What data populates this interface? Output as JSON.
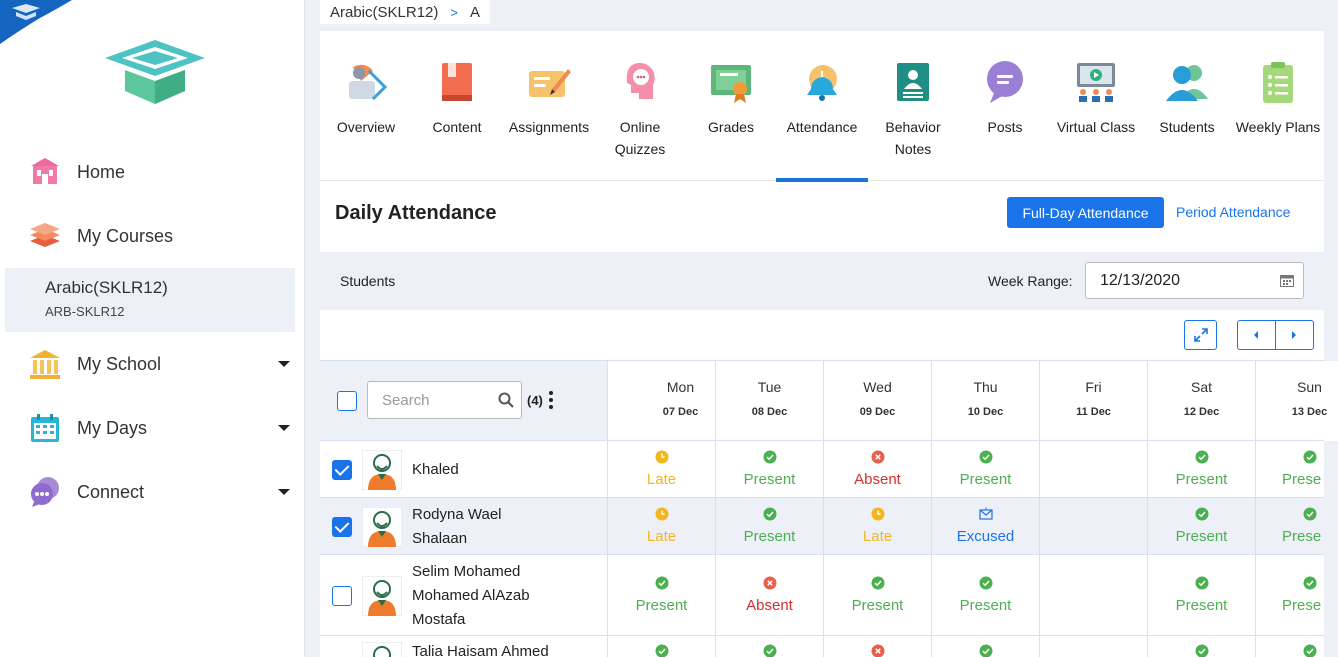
{
  "sidebar": {
    "items": [
      {
        "label": "Home",
        "icon": "school-building-icon"
      },
      {
        "label": "My Courses",
        "icon": "books-stack-icon"
      },
      {
        "label": "My School",
        "icon": "institution-icon"
      },
      {
        "label": "My Days",
        "icon": "calendar-icon"
      },
      {
        "label": "Connect",
        "icon": "chat-bubble-icon"
      }
    ],
    "course": {
      "name": "Arabic(SKLR12)",
      "code": "ARB-SKLR12"
    }
  },
  "breadcrumb": {
    "course": "Arabic(SKLR12)",
    "separator": ">",
    "section": "A"
  },
  "tabs": [
    {
      "label": "Overview",
      "icon": "overview-icon"
    },
    {
      "label": "Content",
      "icon": "book-icon"
    },
    {
      "label": "Assignments",
      "icon": "assignment-icon"
    },
    {
      "label": "Online Quizzes",
      "icon": "quiz-icon"
    },
    {
      "label": "Grades",
      "icon": "certificate-icon"
    },
    {
      "label": "Attendance",
      "icon": "alarm-bell-icon",
      "active": true
    },
    {
      "label": "Behavior Notes",
      "icon": "behavior-icon"
    },
    {
      "label": "Posts",
      "icon": "speech-bubble-icon"
    },
    {
      "label": "Virtual Class",
      "icon": "virtual-class-icon"
    },
    {
      "label": "Students",
      "icon": "students-icon"
    },
    {
      "label": "Weekly Plans",
      "icon": "checklist-icon"
    }
  ],
  "attendance": {
    "title": "Daily Attendance",
    "full_day_label": "Full-Day Attendance",
    "period_label": "Period Attendance",
    "students_label": "Students",
    "week_range_label": "Week Range:",
    "week_range_value": "12/13/2020",
    "search_placeholder": "Search",
    "count": "(4)"
  },
  "days": [
    {
      "name": "Mon",
      "date": "07 Dec"
    },
    {
      "name": "Tue",
      "date": "08 Dec"
    },
    {
      "name": "Wed",
      "date": "09 Dec"
    },
    {
      "name": "Thu",
      "date": "10 Dec"
    },
    {
      "name": "Fri",
      "date": "11 Dec"
    },
    {
      "name": "Sat",
      "date": "12 Dec"
    },
    {
      "name": "Sun",
      "date": "13 Dec"
    }
  ],
  "students": [
    {
      "name_lines": [
        "Khaled"
      ],
      "checked": true,
      "statuses": [
        "Late",
        "Present",
        "Absent",
        "Present",
        "",
        "Present",
        "Prese"
      ]
    },
    {
      "name_lines": [
        "Rodyna Wael",
        "Shalaan"
      ],
      "checked": true,
      "statuses": [
        "Late",
        "Present",
        "Late",
        "Excused",
        "",
        "Present",
        "Prese"
      ]
    },
    {
      "name_lines": [
        "Selim Mohamed",
        "Mohamed AlAzab",
        "Mostafa"
      ],
      "checked": false,
      "statuses": [
        "Present",
        "Absent",
        "Present",
        "Present",
        "",
        "Present",
        "Prese"
      ]
    },
    {
      "name_lines": [
        "Talia Haisam Ahmed"
      ],
      "checked": false,
      "statuses": [
        "",
        "",
        "",
        "",
        "",
        "",
        ""
      ]
    }
  ],
  "colors": {
    "accent": "#1a73e8",
    "late": "#f3b61f",
    "present": "#4caf50",
    "absent": "#d32f2f",
    "excused": "#1a73e8"
  }
}
